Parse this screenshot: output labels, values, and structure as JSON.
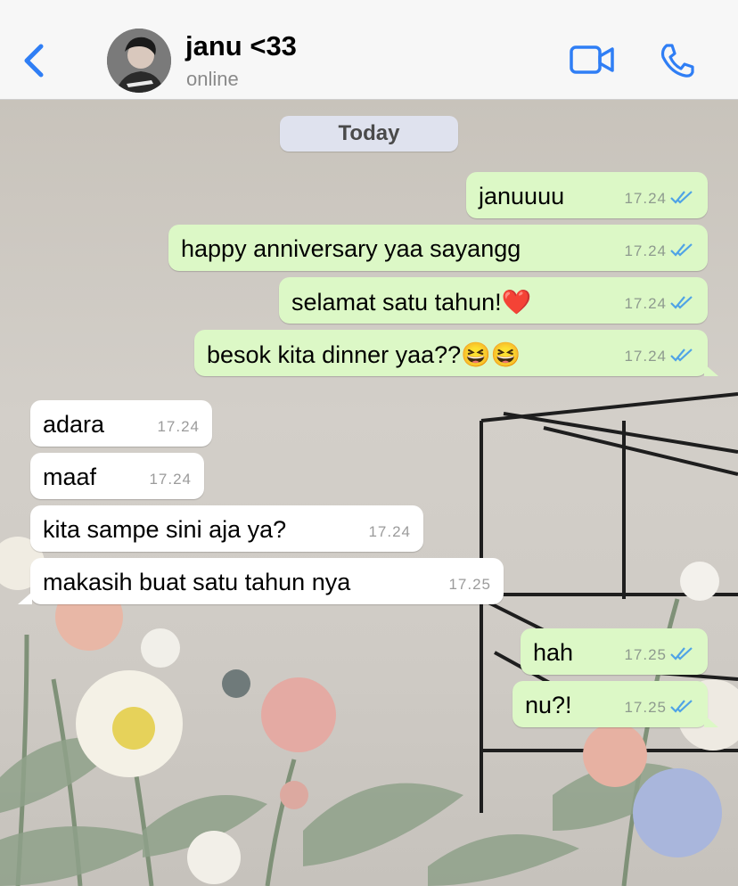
{
  "header": {
    "contact_name": "janu <33",
    "status": "online",
    "back_icon": "chevron-left-icon",
    "video_icon": "video-call-icon",
    "call_icon": "phone-icon",
    "accent_color": "#2f7ef5"
  },
  "chat": {
    "date_label": "Today",
    "messages": [
      {
        "dir": "out",
        "text": "januuuu",
        "time": "17.24",
        "status": "read"
      },
      {
        "dir": "out",
        "text": "happy anniversary yaa sayangg",
        "time": "17.24",
        "status": "read"
      },
      {
        "dir": "out",
        "text": "selamat satu tahun!❤️",
        "time": "17.24",
        "status": "read"
      },
      {
        "dir": "out",
        "text": "besok kita dinner yaa??😆😆",
        "time": "17.24",
        "status": "read"
      },
      {
        "dir": "in",
        "text": "adara",
        "time": "17.24"
      },
      {
        "dir": "in",
        "text": "maaf",
        "time": "17.24"
      },
      {
        "dir": "in",
        "text": "kita sampe sini aja ya?",
        "time": "17.24"
      },
      {
        "dir": "in",
        "text": "makasih buat satu tahun nya",
        "time": "17.25"
      },
      {
        "dir": "out",
        "text": "hah",
        "time": "17.25",
        "status": "read"
      },
      {
        "dir": "out",
        "text": "nu?!",
        "time": "17.25",
        "status": "read"
      }
    ]
  },
  "colors": {
    "outgoing_bubble": "#dcf8c6",
    "incoming_bubble": "#ffffff",
    "read_ticks": "#4fa3e6"
  }
}
